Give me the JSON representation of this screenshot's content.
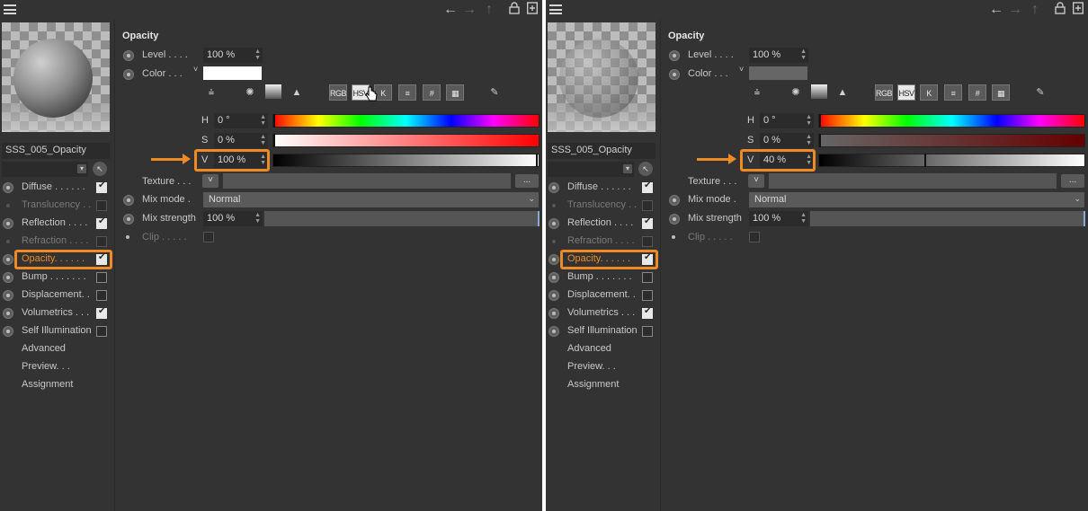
{
  "colors": {
    "accent": "#f08a24",
    "panel_bg": "#333333",
    "field_bg": "#2b2b2b"
  },
  "panels": [
    {
      "id": "left",
      "material_name": "SSS_005_Opacity",
      "section_title": "Opacity",
      "level_label": "Level . . . .",
      "level_value": "100 %",
      "color_label": "Color . . .",
      "color_swatch": "#ffffff",
      "texture_label": "Texture . . .",
      "texture_button": "...",
      "mix_mode_label": "Mix mode .",
      "mix_mode_value": "Normal",
      "mix_strength_label": "Mix strength",
      "mix_strength_value": "100 %",
      "clip_label": "Clip . . . . .",
      "h_label": "H",
      "h_value": "0 °",
      "s_label": "S",
      "s_value": "0 %",
      "v_label": "V",
      "v_value": "100 %",
      "v_level": 1.0,
      "toolbar": {
        "rgb": "RGB",
        "hsv": "HSV",
        "k": "K",
        "hash": "#"
      },
      "channels": [
        {
          "label": "Diffuse . . . . . .",
          "checked": true,
          "enabled": true
        },
        {
          "label": "Translucency . .",
          "checked": false,
          "enabled": false
        },
        {
          "label": "Reflection . . . .",
          "checked": true,
          "enabled": true
        },
        {
          "label": "Refraction . . . .",
          "checked": false,
          "enabled": false
        },
        {
          "label": "Opacity. . . . . .",
          "checked": true,
          "enabled": true,
          "highlight": true
        },
        {
          "label": "Bump . . . . . . .",
          "checked": false,
          "enabled": true
        },
        {
          "label": "Displacement. .",
          "checked": false,
          "enabled": true
        },
        {
          "label": "Volumetrics . . .",
          "checked": true,
          "enabled": true
        },
        {
          "label": "Self Illumination",
          "checked": false,
          "enabled": true
        }
      ],
      "extra_items": [
        "Advanced",
        "Preview. . .",
        "Assignment"
      ]
    },
    {
      "id": "right",
      "material_name": "SSS_005_Opacity",
      "section_title": "Opacity",
      "level_label": "Level . . . .",
      "level_value": "100 %",
      "color_label": "Color . . .",
      "color_swatch": "#666666",
      "texture_label": "Texture . . .",
      "texture_button": "...",
      "mix_mode_label": "Mix mode .",
      "mix_mode_value": "Normal",
      "mix_strength_label": "Mix strength",
      "mix_strength_value": "100 %",
      "clip_label": "Clip . . . . .",
      "h_label": "H",
      "h_value": "0 °",
      "s_label": "S",
      "s_value": "0 %",
      "v_label": "V",
      "v_value": "40 %",
      "v_level": 0.4,
      "toolbar": {
        "rgb": "RGB",
        "hsv": "HSV",
        "k": "K",
        "hash": "#"
      },
      "channels": [
        {
          "label": "Diffuse . . . . . .",
          "checked": true,
          "enabled": true
        },
        {
          "label": "Translucency . .",
          "checked": false,
          "enabled": false
        },
        {
          "label": "Reflection . . . .",
          "checked": true,
          "enabled": true
        },
        {
          "label": "Refraction . . . .",
          "checked": false,
          "enabled": false
        },
        {
          "label": "Opacity. . . . . .",
          "checked": true,
          "enabled": true,
          "highlight": true
        },
        {
          "label": "Bump . . . . . . .",
          "checked": false,
          "enabled": true
        },
        {
          "label": "Displacement. .",
          "checked": false,
          "enabled": true
        },
        {
          "label": "Volumetrics . . .",
          "checked": true,
          "enabled": true
        },
        {
          "label": "Self Illumination",
          "checked": false,
          "enabled": true
        }
      ],
      "extra_items": [
        "Advanced",
        "Preview. . .",
        "Assignment"
      ]
    }
  ]
}
